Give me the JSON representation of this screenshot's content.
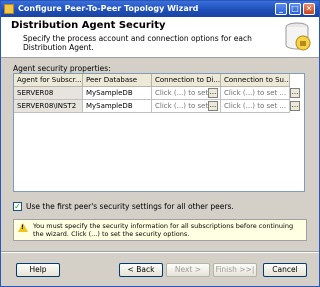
{
  "window": {
    "title": "Configure Peer-To-Peer Topology Wizard",
    "minimize_label": "_",
    "maximize_label": "□",
    "close_label": "✕"
  },
  "header": {
    "title": "Distribution Agent Security",
    "description": "Specify the process account and connection options for each Distribution Agent."
  },
  "security_group_label": "Agent security properties:",
  "grid": {
    "columns": [
      "Agent for Subscr...",
      "Peer Database",
      "Connection to Di...",
      "Connection to Su..."
    ],
    "rows": [
      {
        "agent": "SERVER08",
        "database": "MySampleDB",
        "conn_dist": "Click (...) to set ...",
        "conn_sub": "Click (...) to set ..."
      },
      {
        "agent": "SERVER08\\INST2",
        "database": "MySampleDB",
        "conn_dist": "Click (...) to set ...",
        "conn_sub": "Click (...) to set ..."
      }
    ],
    "ellipsis": "..."
  },
  "use_first_peer": {
    "label": "Use the first peer's security settings for all other peers.",
    "checked": true,
    "check_glyph": "✓"
  },
  "warning": {
    "icon": "warning-icon",
    "mark": "!",
    "text": "You must specify the security information for all subscriptions before continuing the wizard. Click (...) to set the security options."
  },
  "buttons": {
    "help": "Help",
    "back": "< Back",
    "next": "Next >",
    "finish": "Finish >>|",
    "cancel": "Cancel"
  }
}
